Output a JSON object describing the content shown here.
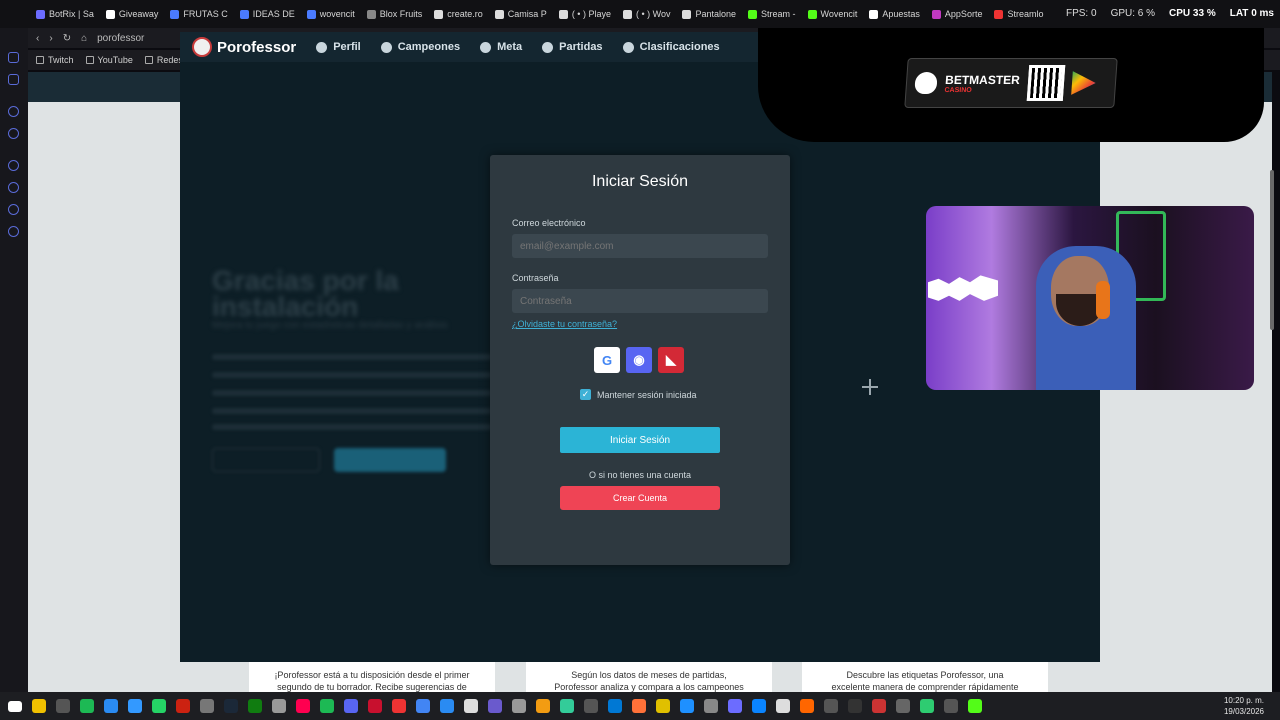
{
  "browser": {
    "tabs": [
      {
        "label": "BotRix | Sa",
        "color": "#6c6cff"
      },
      {
        "label": "Giveaway",
        "color": "#ffffff"
      },
      {
        "label": "FRUTAS C",
        "color": "#4a7bff"
      },
      {
        "label": "IDEAS DE",
        "color": "#4a7bff"
      },
      {
        "label": "wovencit",
        "color": "#4a7bff"
      },
      {
        "label": "Blox Fruits",
        "color": "#888888"
      },
      {
        "label": "create.ro",
        "color": "#dddddd"
      },
      {
        "label": "Camisa P",
        "color": "#dddddd"
      },
      {
        "label": "( • ) Playe",
        "color": "#dddddd"
      },
      {
        "label": "( • ) Wov",
        "color": "#dddddd"
      },
      {
        "label": "Pantalone",
        "color": "#dddddd"
      },
      {
        "label": "Stream - ",
        "color": "#53fc18"
      },
      {
        "label": "Wovencit",
        "color": "#53fc18"
      },
      {
        "label": "Apuestas",
        "color": "#ffffff"
      },
      {
        "label": "AppSorte",
        "color": "#c039c0"
      },
      {
        "label": "Streamlo",
        "color": "#e33"
      }
    ],
    "stats": {
      "fps": "FPS: 0",
      "gpu": "GPU: 6 %",
      "cpu": "CPU 33 %",
      "lat": "LAT 0 ms"
    },
    "address": "porofessor",
    "bookmarks": [
      "Twitch",
      "YouTube",
      "Redes"
    ]
  },
  "site": {
    "brand": "Porofessor",
    "nav": [
      "Perfil",
      "Campeones",
      "Meta",
      "Partidas",
      "Clasificaciones"
    ],
    "bg_title": "Gracias por la instalación",
    "bg_subtitle": "Mejora tu juego con estadísticas detalladas y análisis",
    "bg_btn1": "Inicio",
    "bg_btn2": "Empezar"
  },
  "login": {
    "title": "Iniciar Sesión",
    "email_label": "Correo electrónico",
    "email_placeholder": "email@example.com",
    "password_label": "Contraseña",
    "password_placeholder": "Contraseña",
    "forgot": "¿Olvidaste tu contraseña?",
    "remember": "Mantener sesión iniciada",
    "submit": "Iniciar Sesión",
    "no_account": "O si no tienes una cuenta",
    "create": "Crear Cuenta"
  },
  "cards": [
    {
      "line1": "¡Porofessor está a tu disposición desde el primer",
      "line2": "segundo de tu borrador. Recibe sugerencias de"
    },
    {
      "line1": "Según los datos de meses de partidas,",
      "line2": "Porofessor analiza y compara a los campeones"
    },
    {
      "line1": "Descubre las etiquetas Porofessor, una",
      "line2": "excelente manera de comprender rápidamente"
    }
  ],
  "promo": {
    "brand": "BETMASTER",
    "sub": "CASINO"
  },
  "clock": {
    "time": "10:20 p. m.",
    "date": "19/03/2026"
  }
}
